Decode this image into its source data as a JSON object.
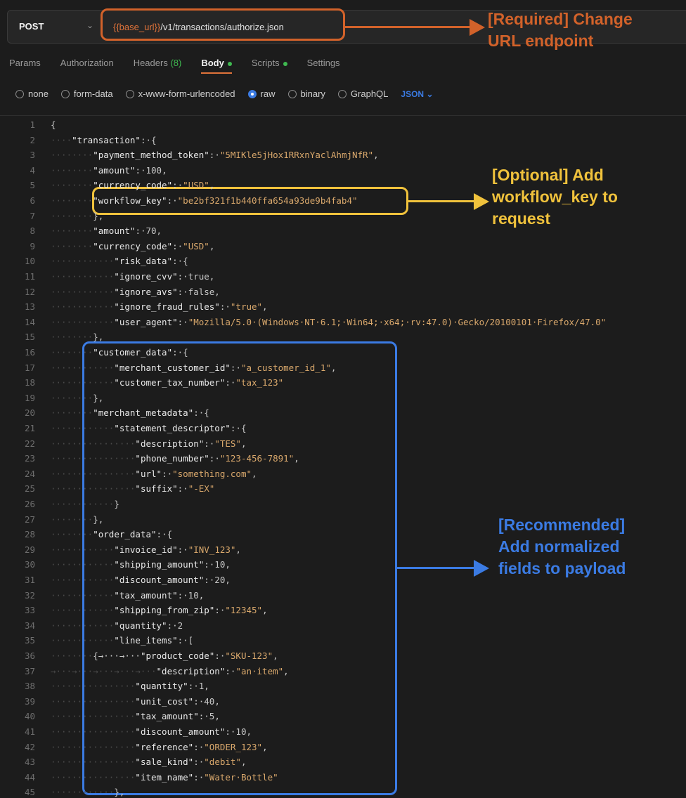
{
  "request": {
    "method": "POST",
    "url_var": "{{base_url}}",
    "url_path": "/v1/transactions/authorize.json"
  },
  "tabs": [
    {
      "label": "Params"
    },
    {
      "label": "Authorization"
    },
    {
      "label": "Headers",
      "count": "(8)"
    },
    {
      "label": "Body",
      "active": true,
      "dot": true
    },
    {
      "label": "Scripts",
      "dot": true
    },
    {
      "label": "Settings"
    }
  ],
  "body_types": [
    "none",
    "form-data",
    "x-www-form-urlencoded",
    "raw",
    "binary",
    "GraphQL"
  ],
  "body_type_selected": "raw",
  "format_selected": "JSON",
  "annotations": {
    "url": "[Required] Change\nURL endpoint",
    "workflow": "[Optional] Add\nworkflow_key to\nrequest",
    "normalized": "[Recommended]\nAdd normalized\nfields to payload"
  },
  "colors": {
    "orange": "#d2622a",
    "yellow": "#f0c23c",
    "blue": "#3b7be3"
  },
  "code_lines": [
    "{",
    "····\"transaction\":·{",
    "········\"payment_method_token\":·\"5MIKle5jHox1RRxnYaclAhmjNfR\",",
    "········\"amount\":·100,",
    "········\"currency_code\":·\"USD\",",
    "········\"workflow_key\":·\"be2bf321f1b440ffa654a93de9b4fab4\"",
    "········},",
    "········\"amount\":·70,",
    "········\"currency_code\":·\"USD\",",
    "············\"risk_data\":·{",
    "············\"ignore_cvv\":·true,",
    "············\"ignore_avs\":·false,",
    "············\"ignore_fraud_rules\":·\"true\",",
    "············\"user_agent\":·\"Mozilla/5.0·(Windows·NT·6.1;·Win64;·x64;·rv:47.0)·Gecko/20100101·Firefox/47.0\"",
    "········},",
    "········\"customer_data\":·{",
    "············\"merchant_customer_id\":·\"a_customer_id_1\",",
    "············\"customer_tax_number\":·\"tax_123\"",
    "········},",
    "········\"merchant_metadata\":·{",
    "············\"statement_descriptor\":·{",
    "················\"description\":·\"TES\",",
    "················\"phone_number\":·\"123-456-7891\",",
    "················\"url\":·\"something.com\",",
    "················\"suffix\":·\"-EX\"",
    "············}",
    "········},",
    "········\"order_data\":·{",
    "············\"invoice_id\":·\"INV_123\",",
    "············\"shipping_amount\":·10,",
    "············\"discount_amount\":·20,",
    "············\"tax_amount\":·10,",
    "············\"shipping_from_zip\":·\"12345\",",
    "············\"quantity\":·2",
    "············\"line_items\":·[",
    "········{→···→···\"product_code\":·\"SKU-123\",",
    "→···→···→···→···→···\"description\":·\"an·item\",",
    "················\"quantity\":·1,",
    "················\"unit_cost\":·40,",
    "················\"tax_amount\":·5,",
    "················\"discount_amount\":·10,",
    "················\"reference\":·\"ORDER_123\",",
    "················\"sale_kind\":·\"debit\",",
    "················\"item_name\":·\"Water·Bottle\"",
    "············},"
  ]
}
